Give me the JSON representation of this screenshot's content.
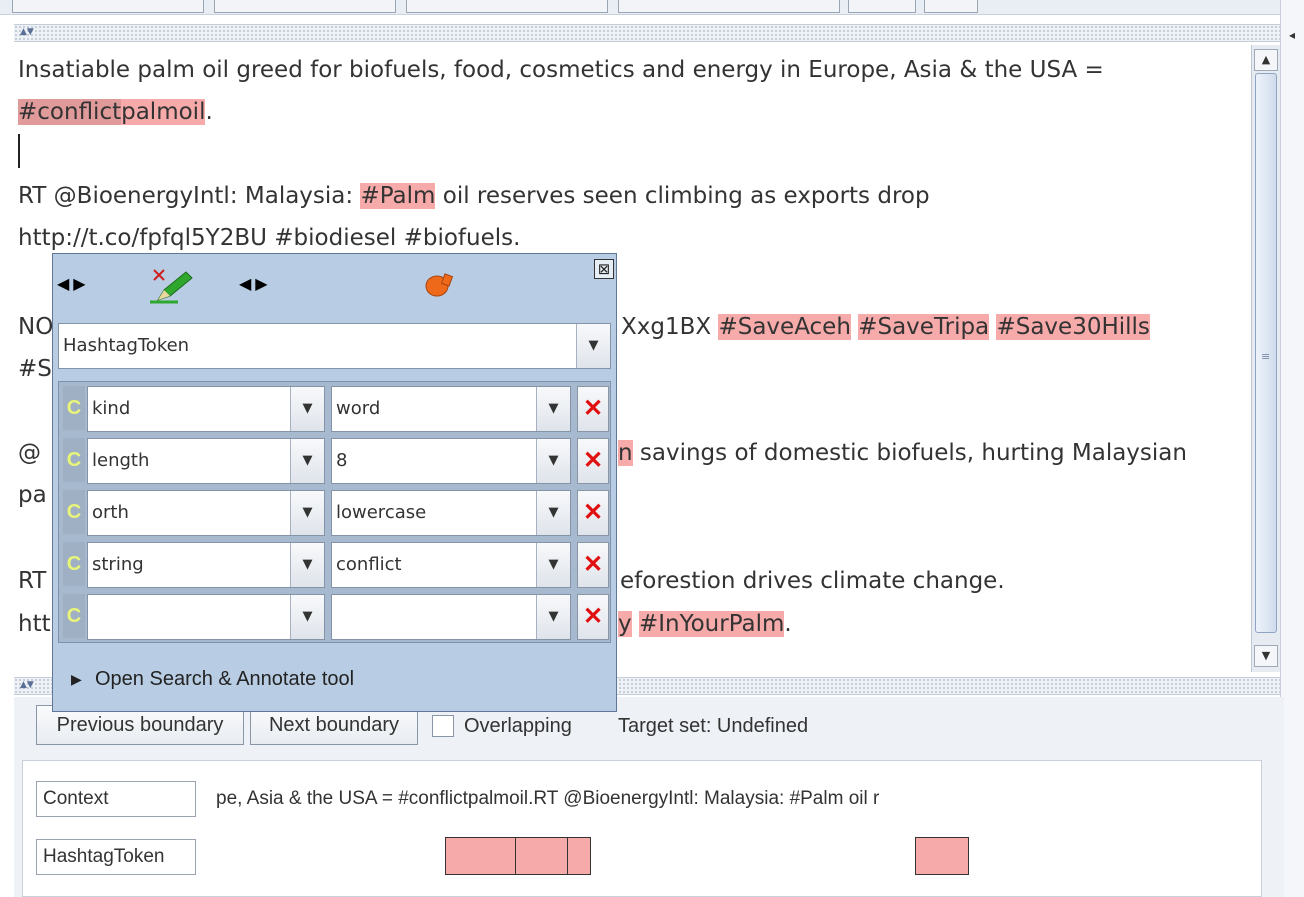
{
  "document": {
    "lines": [
      {
        "segments": [
          {
            "t": "Insatiable palm oil greed for biofuels, food, cosmetics and energy in Europe, Asia & the USA ="
          }
        ]
      },
      {
        "segments": [
          {
            "t": "#conflict",
            "h": "hl2"
          },
          {
            "t": "palm",
            "h": "hl"
          },
          {
            "t": "oil",
            "h": "hl"
          },
          {
            "t": "."
          }
        ]
      },
      {
        "segments": [
          {
            "t": "RT @BioenergyIntl: Malaysia: "
          },
          {
            "t": "#Palm",
            "h": "hl"
          },
          {
            "t": " oil reserves seen climbing as exports drop"
          }
        ]
      },
      {
        "segments": [
          {
            "t": "http://t.co/fpfql5Y2BU #biodiesel #biofuels."
          }
        ]
      },
      {
        "segments": [
          {
            "t": "NO"
          }
        ]
      },
      {
        "segments": [
          {
            "t": "Xxg1BX "
          },
          {
            "t": "#Save",
            "h": "hl"
          },
          {
            "t": "Aceh",
            "h": "hl"
          },
          {
            "t": " "
          },
          {
            "t": "#Save",
            "h": "hl"
          },
          {
            "t": "Tripa",
            "h": "hl"
          },
          {
            "t": " "
          },
          {
            "t": "#Save30",
            "h": "hl"
          },
          {
            "t": "Hills",
            "h": "hl"
          }
        ]
      },
      {
        "segments": [
          {
            "t": "#S"
          }
        ]
      },
      {
        "segments": [
          {
            "t": "@"
          }
        ]
      },
      {
        "segments": [
          {
            "t": "n",
            "h": "hl"
          },
          {
            "t": " savings of domestic biofuels, hurting Malaysian"
          }
        ]
      },
      {
        "segments": [
          {
            "t": "pa"
          }
        ]
      },
      {
        "segments": [
          {
            "t": "RT"
          }
        ]
      },
      {
        "segments": [
          {
            "t": "eforestion drives climate change."
          }
        ]
      },
      {
        "segments": [
          {
            "t": "htt"
          }
        ]
      },
      {
        "segments": [
          {
            "t": "y",
            "h": "hl"
          },
          {
            "t": " "
          },
          {
            "t": "#In",
            "h": "hl"
          },
          {
            "t": "Your",
            "h": "hl"
          },
          {
            "t": "Palm",
            "h": "hl"
          },
          {
            "t": "."
          }
        ]
      }
    ]
  },
  "editor": {
    "type_value": "HashtagToken",
    "features": [
      {
        "name": "kind",
        "value": "word"
      },
      {
        "name": "length",
        "value": "8"
      },
      {
        "name": "orth",
        "value": "lowercase"
      },
      {
        "name": "string",
        "value": "conflict"
      },
      {
        "name": "",
        "value": ""
      }
    ],
    "c_glyph": "C",
    "delete_glyph": "✕",
    "close_glyph": "⊠",
    "open_search_label": "Open Search & Annotate tool"
  },
  "stack": {
    "prev_label": "Previous boundary",
    "next_label": "Next boundary",
    "overlapping_label": "Overlapping",
    "target_set": "Target set: Undefined",
    "context_label": "Context",
    "context_text": "pe, Asia & the USA = #conflictpalmoil.RT @BioenergyIntl: Malaysia: #Palm oil r",
    "row_label": "HashtagToken"
  },
  "colors": {
    "highlight": "#f7aaaa",
    "highlight_selected": "#e09a9a",
    "panel": "#b8cde3"
  }
}
